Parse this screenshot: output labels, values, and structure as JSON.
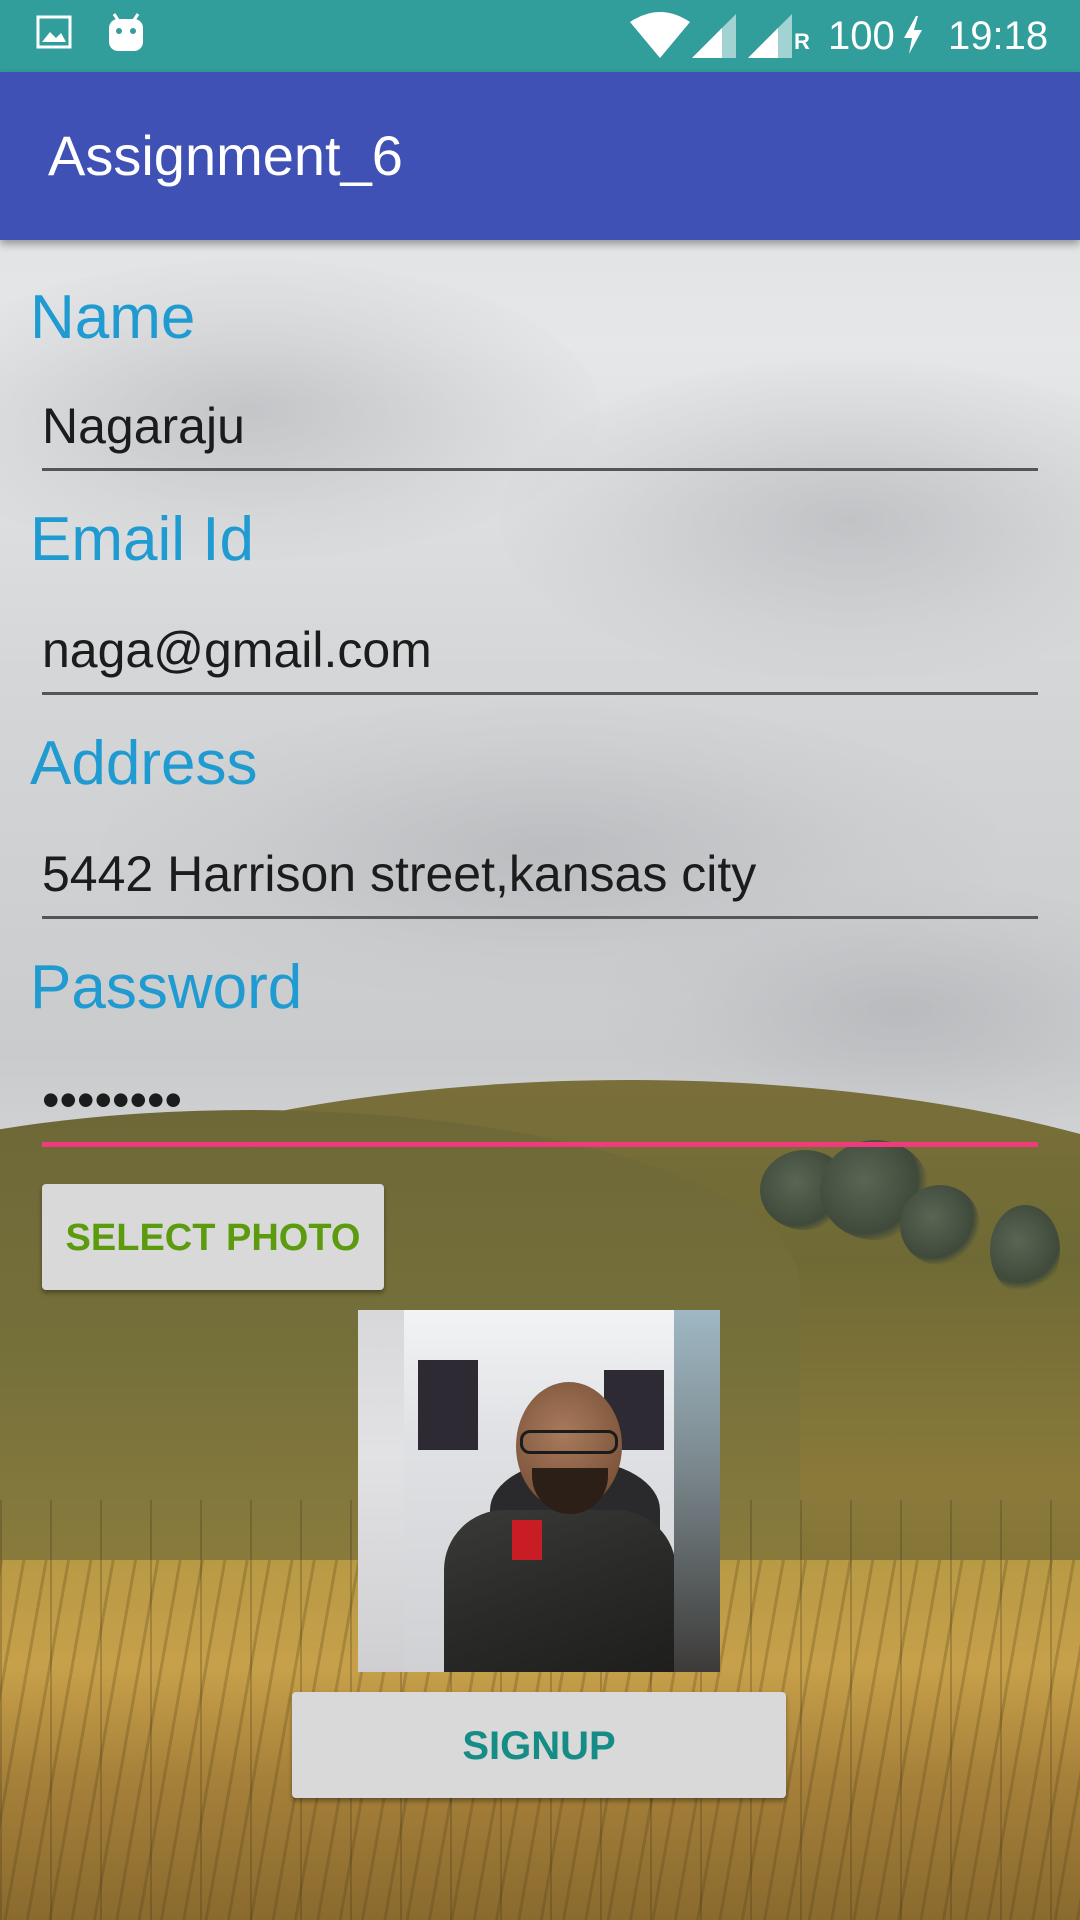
{
  "status_bar": {
    "battery_level": "100",
    "time": "19:18",
    "network_roaming": "R",
    "icons": [
      "image-icon",
      "android-icon",
      "wifi-icon",
      "signal-icon",
      "signal-roaming-icon",
      "charging-icon"
    ]
  },
  "app_bar": {
    "title": "Assignment_6"
  },
  "form": {
    "name_label": "Name",
    "name_value": "Nagaraju",
    "email_label": "Email Id",
    "email_value": "naga@gmail.com",
    "address_label": "Address",
    "address_value": "5442 Harrison street,kansas city",
    "password_label": "Password",
    "password_mask": "••••••••"
  },
  "buttons": {
    "select_photo": "SELECT PHOTO",
    "signup": "SIGNUP"
  },
  "colors": {
    "status_bar": "#329e9c",
    "app_bar": "#3f51b5",
    "label": "#1f9bd1",
    "focus_underline": "#ef3b7c",
    "select_photo_text": "#5d9b0e",
    "signup_text": "#158c86"
  }
}
